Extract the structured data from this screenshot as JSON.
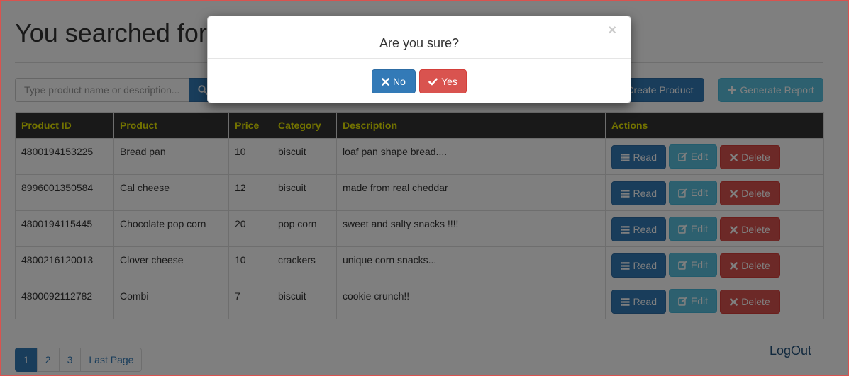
{
  "page": {
    "title": "You searched for",
    "search_placeholder": "Type product name or description...",
    "create_label": "Create Product",
    "report_label": "Generate Report",
    "logout_label": "LogOut"
  },
  "table": {
    "headers": [
      "Product ID",
      "Product",
      "Price",
      "Category",
      "Description",
      "Actions"
    ],
    "rows": [
      {
        "id": "4800194153225",
        "product": "Bread pan",
        "price": "10",
        "category": "biscuit",
        "description": "loaf pan shape bread...."
      },
      {
        "id": "8996001350584",
        "product": "Cal cheese",
        "price": "12",
        "category": "biscuit",
        "description": "made from real cheddar"
      },
      {
        "id": "4800194115445",
        "product": "Chocolate pop corn",
        "price": "20",
        "category": "pop corn",
        "description": "sweet and salty snacks !!!!"
      },
      {
        "id": "4800216120013",
        "product": "Clover cheese",
        "price": "10",
        "category": "crackers",
        "description": "unique corn snacks..."
      },
      {
        "id": "4800092112782",
        "product": "Combi",
        "price": "7",
        "category": "biscuit",
        "description": "cookie crunch!!"
      }
    ],
    "action_labels": {
      "read": "Read",
      "edit": "Edit",
      "delete": "Delete"
    }
  },
  "pagination": {
    "pages": [
      "1",
      "2",
      "3"
    ],
    "active": "1",
    "last_label": "Last Page"
  },
  "modal": {
    "title": "Are you sure?",
    "close": "×",
    "no_label": "No",
    "yes_label": "Yes"
  },
  "colors": {
    "primary": "#337ab7",
    "info": "#5bc0de",
    "danger": "#d9534f",
    "header_bg": "#333333",
    "header_text": "#e6e600",
    "frame_border": "#d9534f"
  },
  "icons": {
    "search": "search-icon",
    "create": "plus-icon",
    "report": "plus-icon",
    "read": "list-icon",
    "edit": "edit-icon",
    "delete": "times-icon",
    "no": "times-icon",
    "yes": "check-icon"
  }
}
